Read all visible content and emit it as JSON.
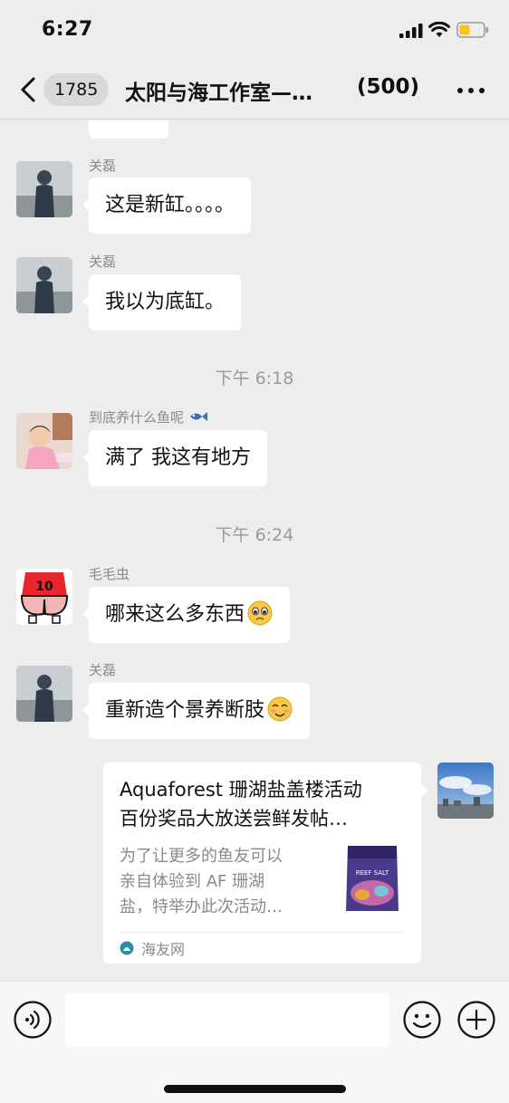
{
  "status_bar": {
    "time": "6:27"
  },
  "nav": {
    "back_icon": "chevron-left-icon",
    "unread_count": "1785",
    "title": "太阳与海工作室—…",
    "member_count": "(500)",
    "more_icon": "more-dots-icon"
  },
  "messages": [
    {
      "type": "text",
      "sender": "关磊",
      "text": "这是新缸。。。。"
    },
    {
      "type": "text",
      "sender": "关磊",
      "text": "我以为底缸。"
    },
    {
      "type": "time",
      "text": "下午 6:18"
    },
    {
      "type": "text",
      "sender": "到底养什么鱼呢",
      "sender_emoji": "fish-icon",
      "text": "满了 我这有地方"
    },
    {
      "type": "time",
      "text": "下午 6:24"
    },
    {
      "type": "text",
      "sender": "毛毛虫",
      "text": "哪来这么多东西",
      "emoji": "pleading-face-icon"
    },
    {
      "type": "text",
      "sender": "关磊",
      "text": "重新造个景养断肢",
      "emoji": "smiling-blush-face-icon"
    },
    {
      "type": "link",
      "title_line1": "Aquaforest 珊湖盐盖楼活动",
      "title_line2": " 百份奖品大放送尝鲜发帖…",
      "desc_line1": "为了让更多的鱼友可以",
      "desc_line2": "亲自体验到 AF 珊湖",
      "desc_line3": "盐，特举办此次活动…",
      "thumb_text": "REEF SALT",
      "source": "海友网"
    }
  ],
  "colors": {
    "background": "#ededed",
    "bubble": "#ffffff",
    "meta_text": "#8a8a8a",
    "battery": "#f5c518"
  }
}
